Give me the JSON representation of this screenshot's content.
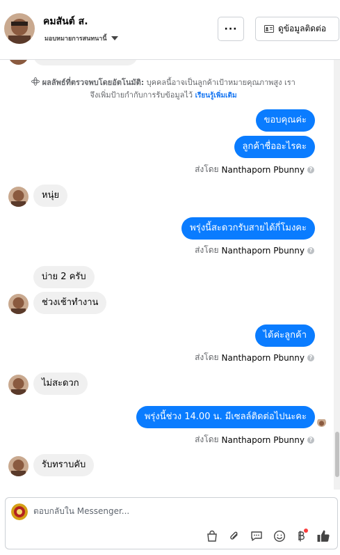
{
  "header": {
    "contact_name": "คมสันต์ ส.",
    "assign_label": "มอบหมายการสนทนานี้",
    "more_label": "···",
    "view_contact_label": "ดูข้อมูลติดต่อ"
  },
  "notice": {
    "bold_text": "ผลลัพธ์ที่ตรวจพบโดยอัตโนมัติ:",
    "line1": "บุคคลนี้อาจเป็นลูกค้าเป้าหมายคุณภาพสูง เรา",
    "line2": "จึงเพิ่มป้ายกำกับการรับข้อมูลไว้",
    "link": "เรียนรู้เพิ่มเติม"
  },
  "messages": {
    "m1": "ขอบคุณค่ะ",
    "m2": "ลูกค้าชื่ออะไรคะ",
    "m3": "หนุ่ย",
    "m4": "พรุ่งนี้สะดวกรับสายได้กี่โมงคะ",
    "m5": "บ่าย 2 ครับ",
    "m6": "ช่วงเช้าทำงาน",
    "m7": "ได้ค่ะลูกค้า",
    "m8": "ไม่สะดวก",
    "m9": "พรุ่งนี้ช่วง 14.00 น. มีเซลล์ติดต่อไปนะคะ",
    "m10": "รับทราบคับ"
  },
  "sent_by": {
    "prefix": "ส่งโดย",
    "name": "Nanthaporn Pbunny",
    "help": "?"
  },
  "composer": {
    "placeholder": "ตอบกลับใน Messenger..."
  },
  "colors": {
    "outgoing_bubble": "#0a7cff",
    "incoming_bubble": "#f0f0f0",
    "link": "#1877f2",
    "notification_dot": "#fa3e3e"
  },
  "icons": [
    "more-icon",
    "contact-card-icon",
    "robot-icon",
    "shop-bag-icon",
    "attach-icon",
    "saved-reply-icon",
    "emoji-icon",
    "baht-icon",
    "like-icon"
  ]
}
